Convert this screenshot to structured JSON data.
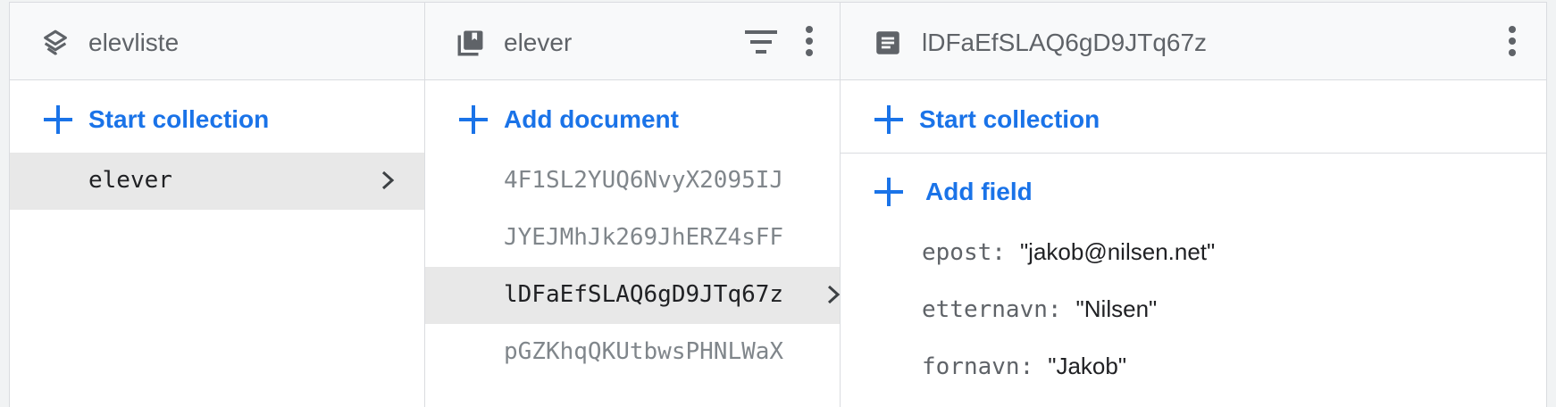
{
  "panels": {
    "root": {
      "title": "elevliste",
      "add_label": "Start collection",
      "items": [
        {
          "label": "elever",
          "selected": true
        }
      ]
    },
    "collection": {
      "title": "elever",
      "add_label": "Add document",
      "items": [
        {
          "label": "4F1SL2YUQ6NvyX2095IJ",
          "selected": false
        },
        {
          "label": "JYEJMhJk269JhERZ4sFF",
          "selected": false
        },
        {
          "label": "lDFaEfSLAQ6gD9JTq67z",
          "selected": true
        },
        {
          "label": "pGZKhqQKUtbwsPHNLWaX",
          "selected": false
        }
      ]
    },
    "document": {
      "title": "lDFaEfSLAQ6gD9JTq67z",
      "add_collection_label": "Start collection",
      "add_field_label": "Add field",
      "fields": [
        {
          "key": "epost",
          "colon": ":",
          "value": "\"jakob@nilsen.net\""
        },
        {
          "key": "etternavn",
          "colon": ":",
          "value": "\"Nilsen\""
        },
        {
          "key": "fornavn",
          "colon": ":",
          "value": "\"Jakob\""
        }
      ]
    }
  },
  "icons": {
    "root": "database-stack-icon",
    "collection": "collection-icon",
    "document": "document-icon",
    "filter": "filter-icon",
    "more": "more-vert-icon",
    "add": "add-icon",
    "chevron": "chevron-right-icon"
  },
  "colors": {
    "accent": "#1a73e8",
    "selected_row": "#e8e8e8",
    "header_bg": "#f8f9fa"
  }
}
